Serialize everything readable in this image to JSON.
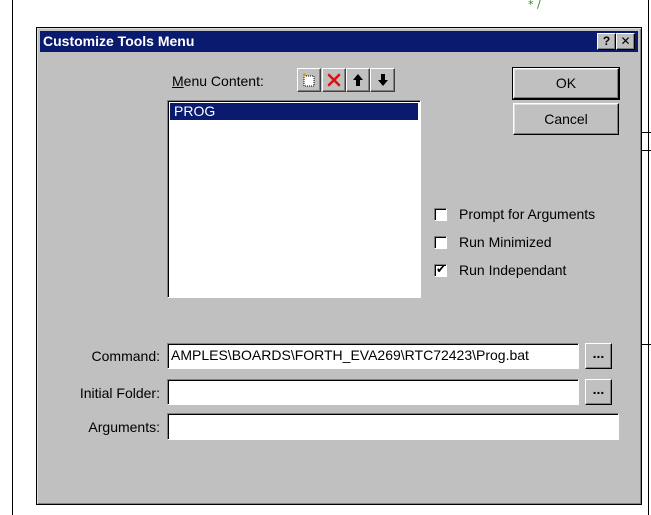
{
  "background": {
    "marker": "* /"
  },
  "dialog": {
    "title": "Customize Tools Menu",
    "help_label": "?",
    "close_label": "✕"
  },
  "menu_content": {
    "label_accel": "M",
    "label_rest": "enu Content:",
    "toolbar_icons": [
      "new-item-icon",
      "delete-icon",
      "move-up-icon",
      "move-down-icon"
    ],
    "items": [
      "PROG"
    ],
    "selected_index": 0
  },
  "buttons": {
    "ok": "OK",
    "cancel": "Cancel"
  },
  "options": [
    {
      "label": "Prompt for  Arguments",
      "checked": false
    },
    {
      "label": "Run Minimized",
      "checked": false
    },
    {
      "label": "Run Independant",
      "checked": true
    }
  ],
  "fields": {
    "command_label": "Command:",
    "command_value": "AMPLES\\BOARDS\\FORTH_EVA269\\RTC72423\\Prog.bat",
    "initial_folder_label": "Initial Folder:",
    "initial_folder_value": "",
    "arguments_label": "Arguments:",
    "arguments_value": "",
    "browse_label": "..."
  },
  "colors": {
    "titlebar": "#0a1a6e",
    "dialog_face": "#c0c0c0",
    "selection": "#0a1a6e",
    "delete_icon": "#e01010"
  }
}
